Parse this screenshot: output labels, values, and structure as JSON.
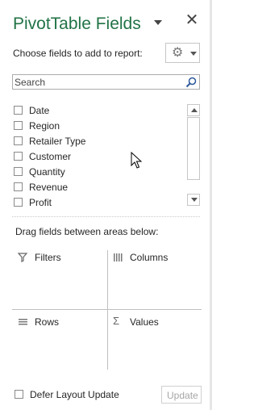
{
  "pane": {
    "title": "PivotTable Fields",
    "close_glyph": "✕",
    "choose_label": "Choose fields to add to report:",
    "tools_icon": "gear-icon",
    "accent_color": "#217346"
  },
  "search": {
    "placeholder": "Search",
    "value": ""
  },
  "fields": [
    {
      "label": "Date",
      "checked": false
    },
    {
      "label": "Region",
      "checked": false
    },
    {
      "label": "Retailer Type",
      "checked": false
    },
    {
      "label": "Customer",
      "checked": false
    },
    {
      "label": "Quantity",
      "checked": false
    },
    {
      "label": "Revenue",
      "checked": false
    },
    {
      "label": "Profit",
      "checked": false
    }
  ],
  "areas": {
    "instruction": "Drag fields between areas below:",
    "filters": "Filters",
    "columns": "Columns",
    "rows": "Rows",
    "values": "Values",
    "values_symbol": "Σ"
  },
  "footer": {
    "defer_label": "Defer Layout Update",
    "defer_checked": false,
    "update_label": "Update"
  }
}
